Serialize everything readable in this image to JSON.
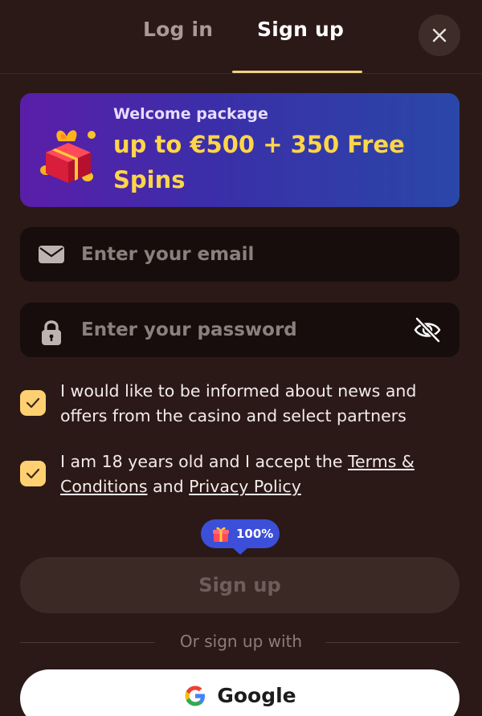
{
  "tabs": {
    "login_label": "Log in",
    "signup_label": "Sign up",
    "active": "signup"
  },
  "banner": {
    "subtitle": "Welcome package",
    "title": "up to €500 + 350 Free Spins",
    "icon": "gift-box-icon"
  },
  "form": {
    "email_placeholder": "Enter your email",
    "password_placeholder": "Enter your password",
    "email_icon": "envelope-icon",
    "password_icon": "lock-icon",
    "visibility_icon": "eye-slash-icon"
  },
  "checkboxes": {
    "news": {
      "label": "I would like to be informed about news and offers from the casino and select partners",
      "checked": true
    },
    "terms": {
      "prefix": "I am 18 years old and I accept the ",
      "terms_link": "Terms & Conditions",
      "and": " and ",
      "privacy_link": "Privacy Policy",
      "checked": true
    }
  },
  "bonus_badge": {
    "label": "100%",
    "icon": "gift-icon"
  },
  "signup_button": {
    "label": "Sign up",
    "disabled": true
  },
  "social": {
    "divider_text": "Or sign up with",
    "google_label": "Google",
    "google_icon": "google-logo-icon"
  },
  "colors": {
    "background": "#2b1917",
    "accent": "#f0d080",
    "checkbox": "#ffd071",
    "banner_title": "#ffd54a",
    "badge": "#3c4fd8"
  }
}
